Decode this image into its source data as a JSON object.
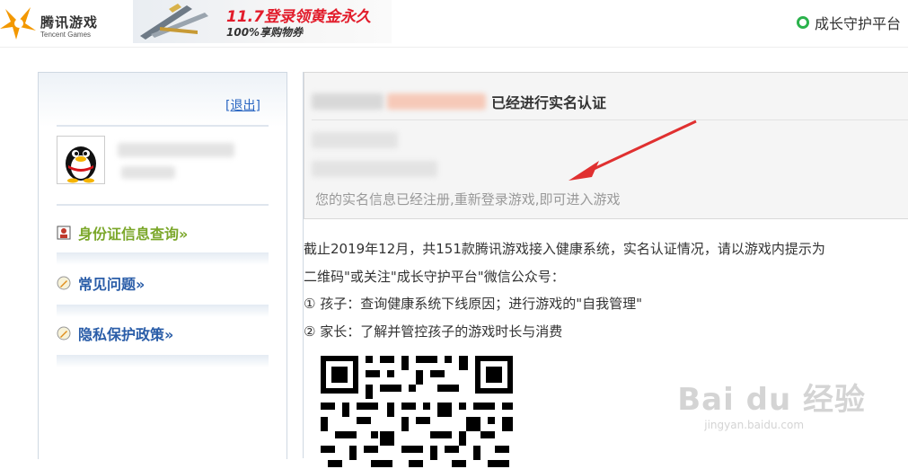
{
  "header": {
    "logo_cn": "腾讯游戏",
    "logo_en": "Tencent Games",
    "banner_line1": "11.7登录领黄金永久",
    "banner_line2": "100%享购物券",
    "guard_label": "成长守护平台",
    "colors": {
      "banner_red": "#e21c2b",
      "guard_green": "#2bb24c"
    }
  },
  "sidebar": {
    "logout": "[退出]",
    "menu": [
      {
        "label": "身份证信息查询»",
        "icon": "id-card-icon",
        "color": "#7ba72a"
      },
      {
        "label": "常见问题»",
        "icon": "pencil-icon",
        "color": "#2a5da8"
      },
      {
        "label": "隐私保护政策»",
        "icon": "pencil-icon",
        "color": "#2a5da8"
      }
    ]
  },
  "notice": {
    "title_suffix": "已经进行实名认证",
    "message": "您的实名信息已经注册,重新登录游戏,即可进入游戏"
  },
  "content": {
    "line1": "截止2019年12月，共151款腾讯游戏接入健康系统，实名认证情况，请以游戏内提示为",
    "line2": "二维码\"或关注\"成长守护平台\"微信公众号：",
    "line3": "① 孩子：查询健康系统下线原因；进行游戏的\"自我管理\"",
    "line4": "② 家长：了解并管控孩子的游戏时长与消费"
  },
  "watermark": {
    "main": "Bai du 经验",
    "sub": "jingyan.baidu.com"
  }
}
